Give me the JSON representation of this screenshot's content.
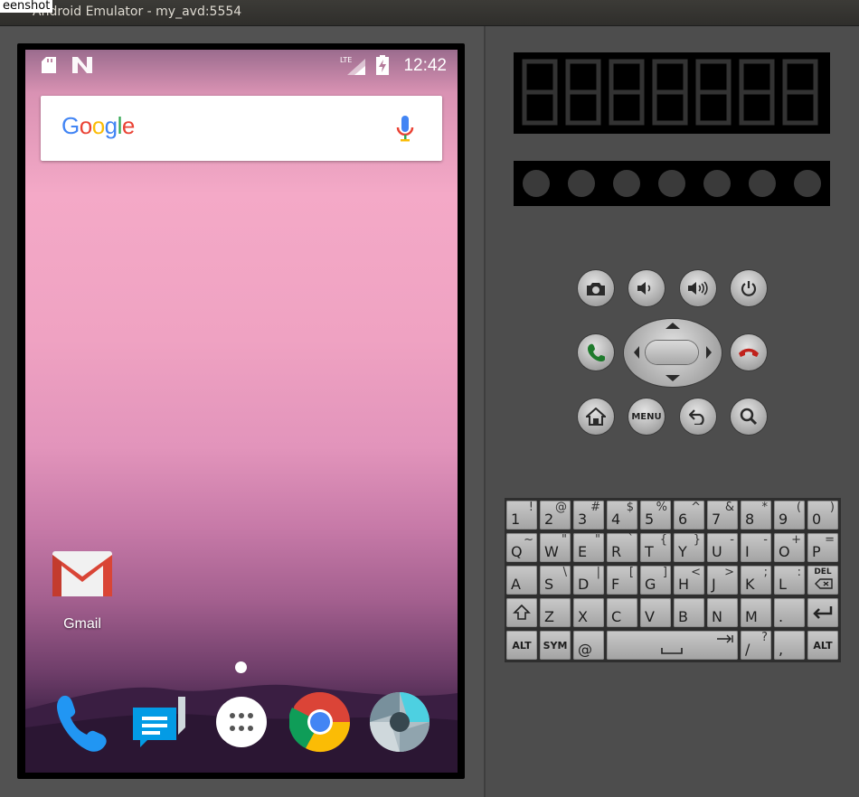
{
  "window": {
    "title": "Android Emulator - my_avd:5554",
    "overlay_label": "eenshot"
  },
  "statusbar": {
    "time": "12:42",
    "network": "LTE"
  },
  "search": {
    "logo_text": "Google"
  },
  "apps": {
    "gmail_label": "Gmail"
  },
  "dock": [
    "phone-icon",
    "messages-icon",
    "app-drawer-icon",
    "chrome-icon",
    "camera-icon"
  ],
  "controls": {
    "menu_label": "MENU"
  },
  "keyboard": {
    "row1": [
      [
        "1",
        "!"
      ],
      [
        "2",
        "@"
      ],
      [
        "3",
        "#"
      ],
      [
        "4",
        "$"
      ],
      [
        "5",
        "%"
      ],
      [
        "6",
        "^"
      ],
      [
        "7",
        "&"
      ],
      [
        "8",
        "*"
      ],
      [
        "9",
        "("
      ],
      [
        "0",
        ")"
      ]
    ],
    "row2": [
      [
        "Q",
        "~"
      ],
      [
        "W",
        "\""
      ],
      [
        "E",
        "\""
      ],
      [
        "R",
        "`"
      ],
      [
        "T",
        "{"
      ],
      [
        "Y",
        "}"
      ],
      [
        "U",
        "-"
      ],
      [
        "I",
        "-"
      ],
      [
        "O",
        "+"
      ],
      [
        "P",
        "="
      ]
    ],
    "row3": [
      [
        "A",
        ""
      ],
      [
        "S",
        "\\"
      ],
      [
        "D",
        "|"
      ],
      [
        "F",
        "["
      ],
      [
        "G",
        "]"
      ],
      [
        "H",
        "<"
      ],
      [
        "J",
        ">"
      ],
      [
        "K",
        ";"
      ],
      [
        "L",
        ":"
      ]
    ],
    "row4": [
      "Z",
      "X",
      "C",
      "V",
      "B",
      "N",
      "M",
      "."
    ],
    "del": "DEL",
    "alt_left": "ALT",
    "sym": "SYM",
    "at": "@",
    "slash": [
      "/",
      "?"
    ],
    "comma": ",",
    "alt_right": "ALT"
  }
}
